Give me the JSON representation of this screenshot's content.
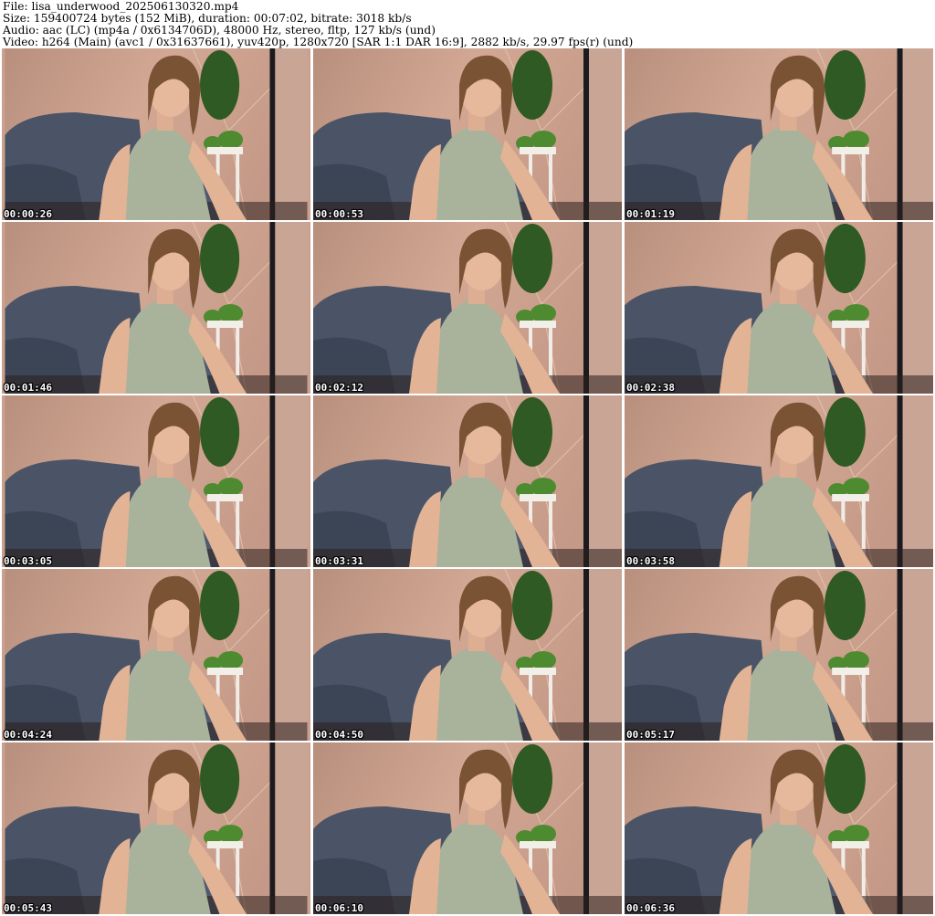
{
  "header": {
    "file_line": "File: lisa_underwood_202506130320.mp4",
    "size_line": "Size: 159400724 bytes (152 MiB), duration: 00:07:02, bitrate: 3018 kb/s",
    "audio_line": "Audio: aac (LC) (mp4a / 0x6134706D), 48000 Hz, stereo, fltp, 127 kb/s (und)",
    "video_line": "Video: h264 (Main) (avc1 / 0x31637661), yuv420p, 1280x720 [SAR 1:1 DAR 16:9], 2882 kb/s, 29.97 fps(r) (und)"
  },
  "thumbnails": [
    {
      "timestamp": "00:00:26",
      "icon": "webcam-video-frame"
    },
    {
      "timestamp": "00:00:53",
      "icon": "webcam-video-frame"
    },
    {
      "timestamp": "00:01:19",
      "icon": "webcam-video-frame"
    },
    {
      "timestamp": "00:01:46",
      "icon": "webcam-video-frame"
    },
    {
      "timestamp": "00:02:12",
      "icon": "webcam-video-frame"
    },
    {
      "timestamp": "00:02:38",
      "icon": "webcam-video-frame"
    },
    {
      "timestamp": "00:03:05",
      "icon": "webcam-video-frame"
    },
    {
      "timestamp": "00:03:31",
      "icon": "webcam-video-frame"
    },
    {
      "timestamp": "00:03:58",
      "icon": "webcam-video-frame"
    },
    {
      "timestamp": "00:04:24",
      "icon": "webcam-video-frame"
    },
    {
      "timestamp": "00:04:50",
      "icon": "webcam-video-frame"
    },
    {
      "timestamp": "00:05:17",
      "icon": "webcam-video-frame"
    },
    {
      "timestamp": "00:05:43",
      "icon": "webcam-video-frame"
    },
    {
      "timestamp": "00:06:10",
      "icon": "webcam-video-frame"
    },
    {
      "timestamp": "00:06:36",
      "icon": "webcam-video-frame"
    }
  ],
  "colors": {
    "wall": "#c79c88",
    "chair": "#4c5668",
    "top": "#a9b39b",
    "skin": "#e3b396",
    "hair": "#7a5335",
    "plant": "#3f7a2e",
    "floor": "#2a1f1e"
  }
}
